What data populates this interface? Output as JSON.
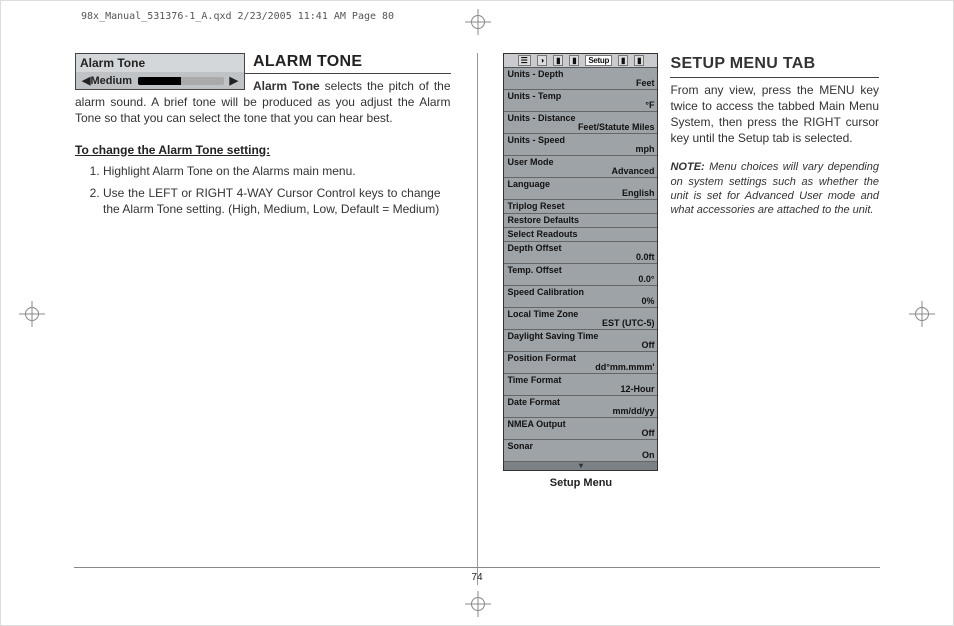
{
  "file_header": "98x_Manual_531376-1_A.qxd  2/23/2005  11:41 AM  Page 80",
  "page_number": "74",
  "alarm_box": {
    "title": "Alarm Tone",
    "arrow_left": "◀",
    "arrow_right": "▶",
    "value": "Medium"
  },
  "left": {
    "heading": "ALARM TONE",
    "lead_strong": "Alarm Tone",
    "lead_rest": " selects the pitch of the alarm sound. A brief tone will be produced as you adjust the Alarm Tone so that you can select the tone that you can hear best.",
    "sub_heading": "To change the Alarm Tone setting:",
    "steps": [
      "Highlight Alarm Tone on the Alarms main menu.",
      "Use the LEFT or RIGHT 4-WAY Cursor Control keys to change the Alarm Tone setting. (High, Medium, Low, Default = Medium)"
    ]
  },
  "right": {
    "heading": "SETUP MENU TAB",
    "body": "From any view, press the MENU key twice to access the tabbed Main Menu System, then press the RIGHT cursor key until the Setup tab is selected.",
    "note_label": "NOTE:",
    "note_body": " Menu choices will vary depending on system settings such as whether the unit is set for Advanced User mode and what accessories are attached to the unit."
  },
  "setup_menu": {
    "tab_label": "Setup",
    "caption": "Setup Menu",
    "rows": [
      {
        "label": "Units - Depth",
        "value": "Feet"
      },
      {
        "label": "Units - Temp",
        "value": "°F"
      },
      {
        "label": "Units - Distance",
        "value": "Feet/Statute Miles"
      },
      {
        "label": "Units - Speed",
        "value": "mph"
      },
      {
        "label": "User Mode",
        "value": "Advanced"
      },
      {
        "label": "Language",
        "value": "English"
      },
      {
        "label": "Triplog Reset",
        "value": ""
      },
      {
        "label": "Restore Defaults",
        "value": ""
      },
      {
        "label": "Select Readouts",
        "value": ""
      },
      {
        "label": "Depth Offset",
        "value": "0.0ft"
      },
      {
        "label": "Temp. Offset",
        "value": "0.0°"
      },
      {
        "label": "Speed Calibration",
        "value": "0%"
      },
      {
        "label": "Local Time Zone",
        "value": "EST (UTC-5)"
      },
      {
        "label": "Daylight Saving Time",
        "value": "Off"
      },
      {
        "label": "Position Format",
        "value": "dd°mm.mmm'"
      },
      {
        "label": "Time Format",
        "value": "12-Hour"
      },
      {
        "label": "Date Format",
        "value": "mm/dd/yy"
      },
      {
        "label": "NMEA Output",
        "value": "Off"
      },
      {
        "label": "Sonar",
        "value": "On"
      }
    ]
  }
}
